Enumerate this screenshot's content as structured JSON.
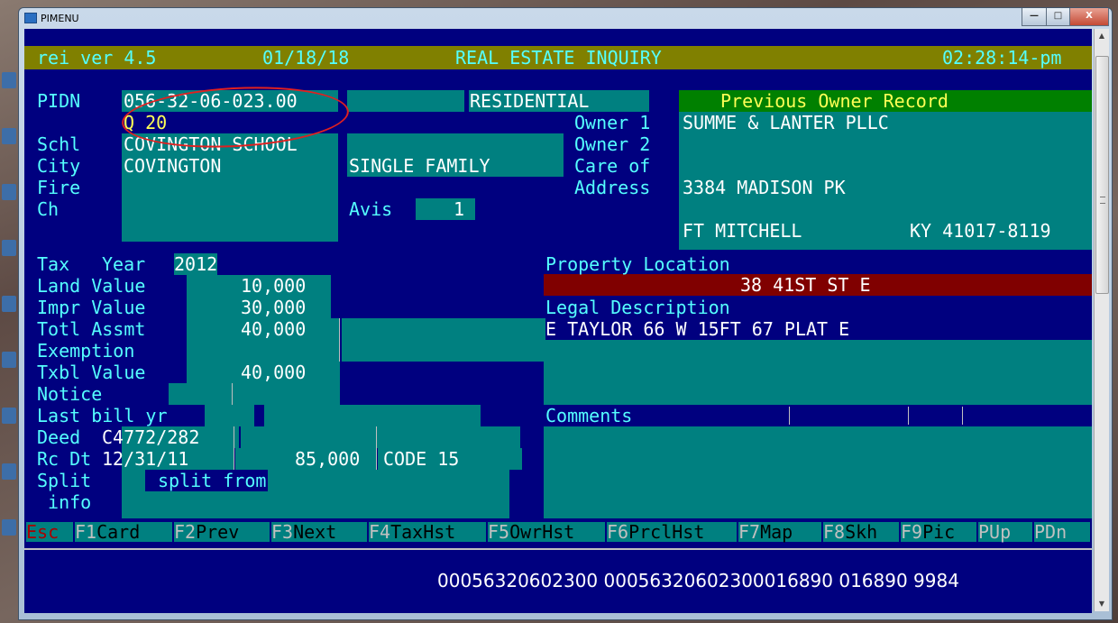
{
  "window": {
    "title": "PIMENU",
    "minimize": "—",
    "maximize": "□",
    "close": "X"
  },
  "header": {
    "app_version": "rei ver 4.5",
    "date": "01/18/18",
    "screen_title": "REAL ESTATE INQUIRY",
    "time": "02:28:14-pm"
  },
  "parcel": {
    "pidn_label": "PIDN",
    "pidn": "056-32-06-023.00",
    "class": "RESIDENTIAL",
    "sub_code": "Q 20",
    "schl_label": "Schl",
    "school": "COVINGTON SCHOOL",
    "city_label": "City",
    "city": "COVINGTON",
    "use": "SINGLE FAMILY",
    "fire_label": "Fire",
    "ch_label": "Ch",
    "avis_label": "Avis",
    "avis": "1"
  },
  "owner": {
    "banner": "Previous Owner Record",
    "owner1_label": "Owner 1",
    "owner1": "SUMME & LANTER PLLC",
    "owner2_label": "Owner 2",
    "careof_label": "Care of",
    "address_label": "Address",
    "address": "3384 MADISON PK",
    "city": "FT MITCHELL",
    "state_zip": "KY 41017-8119"
  },
  "tax": {
    "tax_label": "Tax",
    "year_label": "Year",
    "year": "2012",
    "land_label": "Land Value",
    "land_value": "10,000",
    "impr_label": "Impr Value",
    "impr_value": "30,000",
    "totl_label": "Totl Assmt",
    "totl_assmt": "40,000",
    "exemption_label": "Exemption",
    "txbl_label": "Txbl Value",
    "txbl_value": "40,000",
    "notice_label": "Notice",
    "last_bill_label": "Last bill yr",
    "deed_label": "Deed",
    "deed": "C4772/282",
    "rcdt_label": "Rc Dt",
    "rc_date": "12/31/11",
    "sale_amount": "85,000",
    "code": "CODE 15",
    "split_label": "Split",
    "split_from": "split from",
    "info_label": " info"
  },
  "property": {
    "location_label": "Property Location",
    "location": "38 41ST ST E",
    "legal_label": "Legal Description",
    "legal": "E TAYLOR 66 W 15FT 67 PLAT E",
    "comments_label": "Comments"
  },
  "fkeys": [
    {
      "key": "Esc",
      "label": ""
    },
    {
      "key": "F1",
      "label": "Card"
    },
    {
      "key": "F2",
      "label": "Prev"
    },
    {
      "key": "F3",
      "label": "Next"
    },
    {
      "key": "F4",
      "label": "TaxHst"
    },
    {
      "key": "F5",
      "label": "OwrHst"
    },
    {
      "key": "F6",
      "label": "PrclHst"
    },
    {
      "key": "F7",
      "label": "Map"
    },
    {
      "key": "F8",
      "label": "Skh"
    },
    {
      "key": "F9",
      "label": "Pic"
    },
    {
      "key": "PUp",
      "label": ""
    },
    {
      "key": "PDn",
      "label": ""
    }
  ],
  "status": {
    "codes": "00056320602300 00056320602300016890 016890 9984"
  },
  "colors": {
    "screen_bg": "#00007f",
    "field_bg": "#008080",
    "header_bg": "#808000",
    "owner_banner": "#008000",
    "location_bar": "#800000",
    "annotation": "#e02020"
  }
}
